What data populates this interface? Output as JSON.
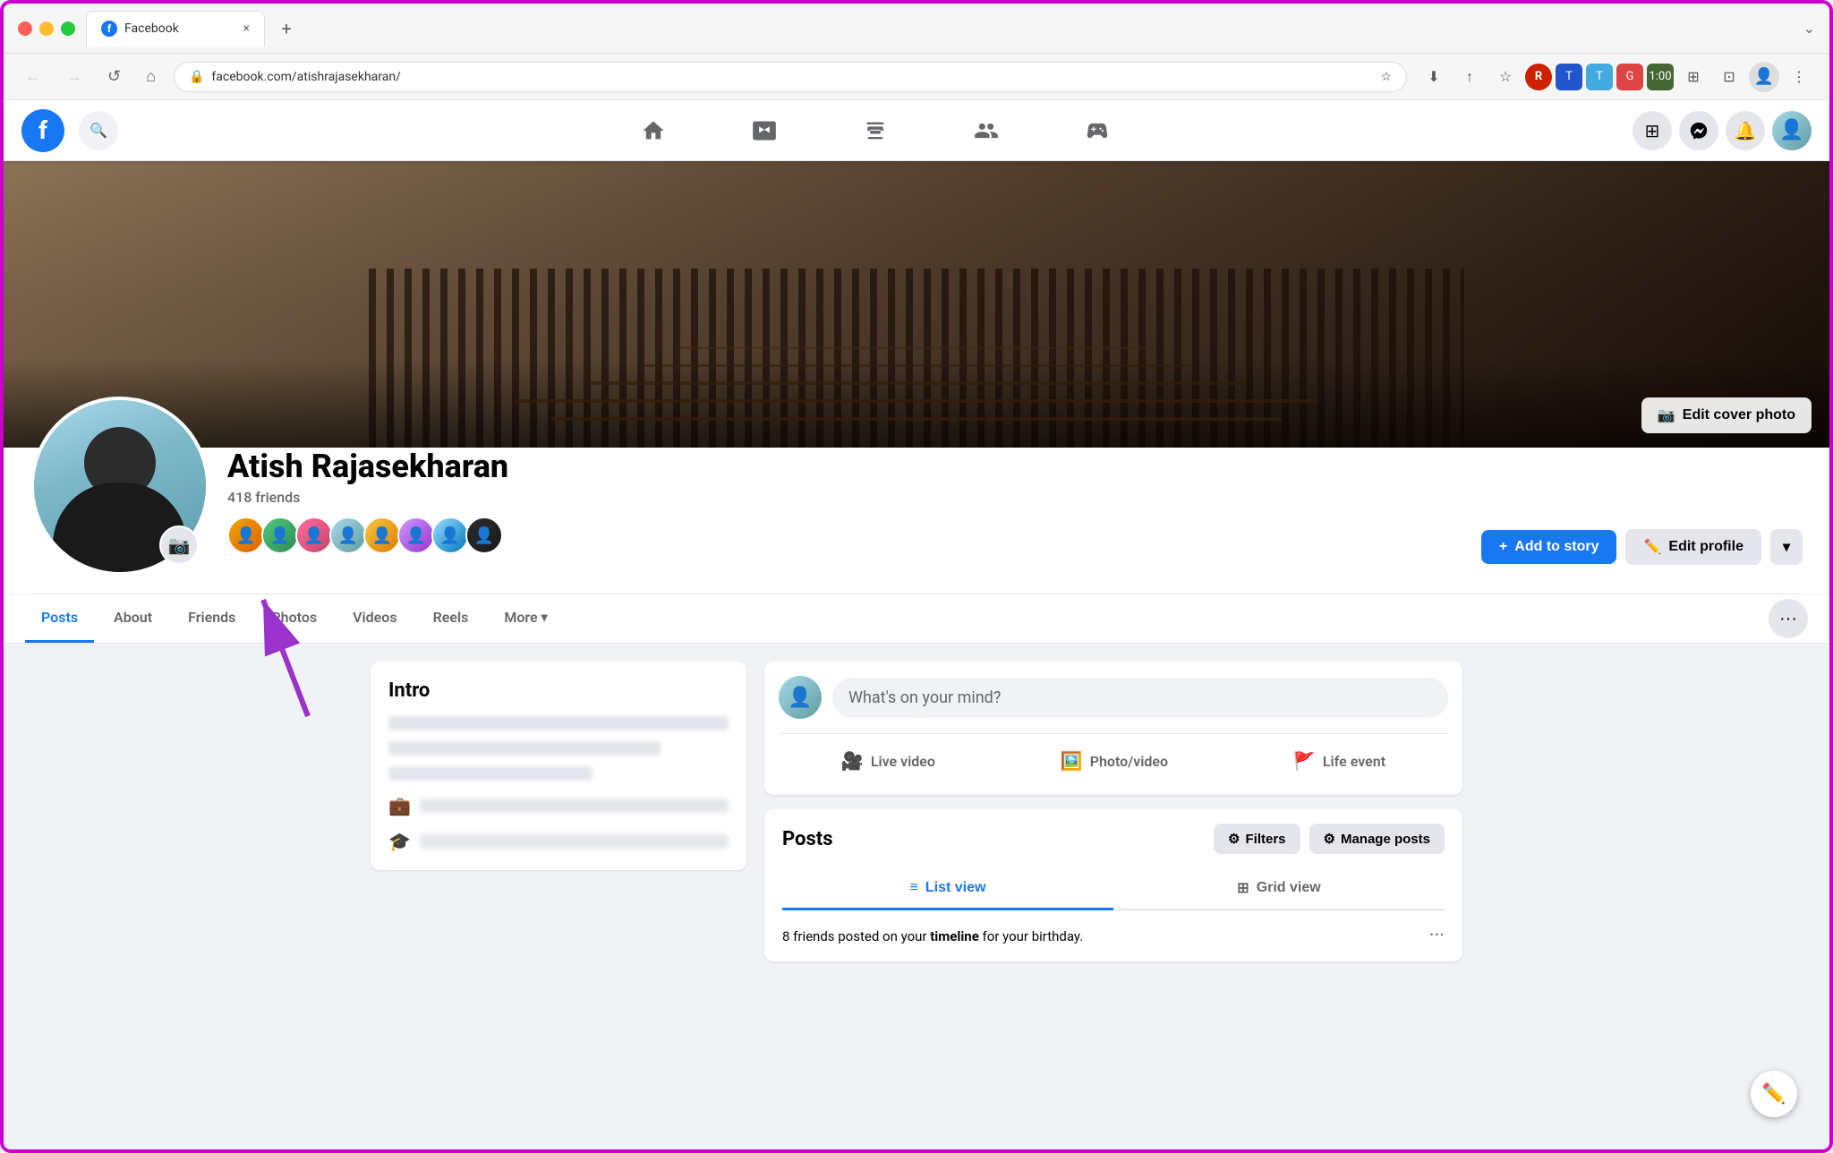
{
  "browser": {
    "tab_title": "Facebook",
    "tab_favicon": "f",
    "url": "facebook.com/atishrajasekharan/",
    "close_label": "×",
    "new_tab_label": "+",
    "window_controls": {
      "minimize": "",
      "maximize": "",
      "close": ""
    }
  },
  "facebook": {
    "logo": "f",
    "search_placeholder": "Search Facebook",
    "nav_icons": [
      "home",
      "video",
      "store",
      "groups",
      "gaming"
    ],
    "right_actions": {
      "apps_label": "⊞",
      "messenger_label": "💬",
      "notifications_label": "🔔"
    }
  },
  "profile": {
    "name": "Atish Rajasekharan",
    "friends_count": "418 friends",
    "cover_photo_btn": "Edit cover photo",
    "add_story_btn": "Add to story",
    "edit_profile_btn": "Edit profile",
    "more_dropdown": "▾",
    "tabs": [
      {
        "label": "Posts",
        "active": true
      },
      {
        "label": "About",
        "active": false
      },
      {
        "label": "Friends",
        "active": false
      },
      {
        "label": "Photos",
        "active": false
      },
      {
        "label": "Videos",
        "active": false
      },
      {
        "label": "Reels",
        "active": false
      },
      {
        "label": "More",
        "active": false
      }
    ],
    "more_icon": "▾",
    "tab_options_icon": "···"
  },
  "intro": {
    "title": "Intro"
  },
  "composer": {
    "placeholder": "What's on your mind?",
    "actions": [
      {
        "label": "Live video",
        "icon": "live"
      },
      {
        "label": "Photo/video",
        "icon": "photo"
      },
      {
        "label": "Life event",
        "icon": "event"
      }
    ]
  },
  "posts_section": {
    "title": "Posts",
    "filter_btn": "Filters",
    "manage_btn": "Manage posts",
    "list_view_btn": "List view",
    "grid_view_btn": "Grid view",
    "birthday_notice": "8 friends posted on your",
    "timeline_word": "timeline",
    "birthday_end": "for your birthday."
  }
}
